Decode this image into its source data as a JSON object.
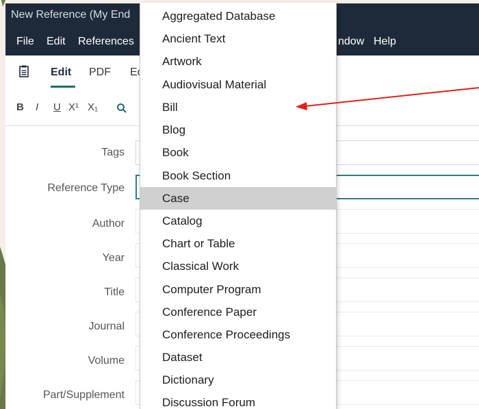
{
  "window": {
    "title": "New Reference (My End"
  },
  "menubar": {
    "items": [
      "File",
      "Edit",
      "References",
      "ndow",
      "Help"
    ]
  },
  "tabs": {
    "items": [
      "Edit",
      "PDF",
      "Ec"
    ]
  },
  "format_toolbar": {
    "bold": "B",
    "italic": "I",
    "underline": "U",
    "superscript": "X¹",
    "subscript": "X₁",
    "search_icon": "🔍"
  },
  "form": {
    "labels": [
      "Tags",
      "Reference Type",
      "Author",
      "Year",
      "Title",
      "Journal",
      "Volume",
      "Part/Supplement"
    ]
  },
  "dropdown": {
    "selected": "Case",
    "options": [
      "Aggregated Database",
      "Ancient Text",
      "Artwork",
      "Audiovisual Material",
      "Bill",
      "Blog",
      "Book",
      "Book Section",
      "Case",
      "Catalog",
      "Chart or Table",
      "Classical Work",
      "Computer Program",
      "Conference Paper",
      "Conference Proceedings",
      "Dataset",
      "Dictionary",
      "Discussion Forum"
    ]
  },
  "annotation": {
    "arrow_color": "#e0201b",
    "points_to": "Bill"
  },
  "colors": {
    "titlebar": "#1e2a3a",
    "accent": "#1b6f6a",
    "highlight": "#d0d0d0"
  }
}
